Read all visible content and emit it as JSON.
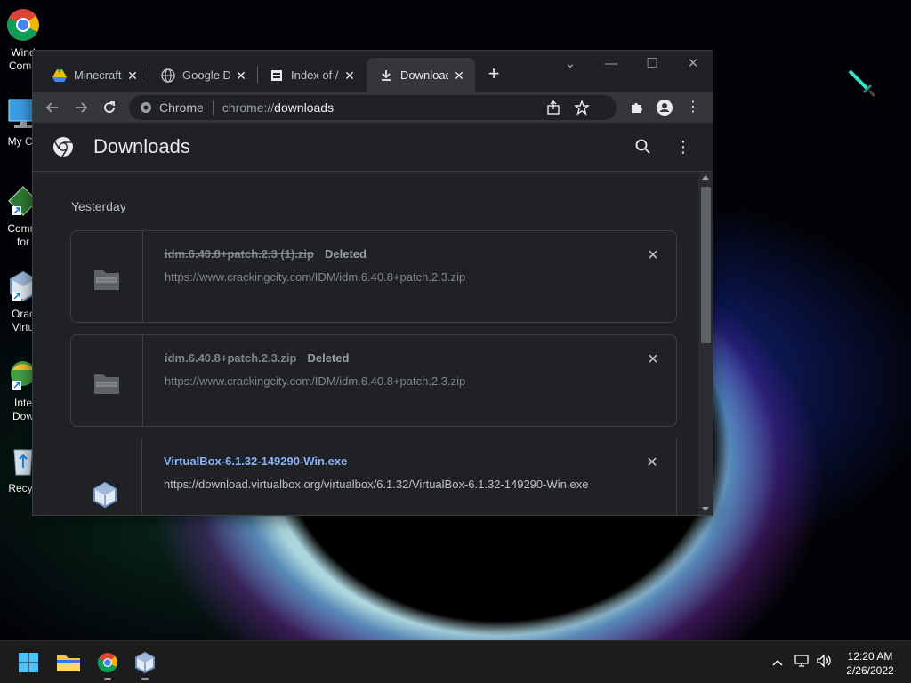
{
  "desktop": {
    "icons": [
      {
        "label": "Wind\nComp"
      },
      {
        "label": "My Co"
      },
      {
        "label": "Comm\nfor"
      },
      {
        "label": "Orac\nVirtu"
      },
      {
        "label": "Inte\nDow"
      },
      {
        "label": "Recyc"
      }
    ]
  },
  "browser": {
    "tabs": [
      {
        "title": "Minecraft",
        "favicon": "google-drive-icon",
        "active": false
      },
      {
        "title": "Google Dr",
        "favicon": "globe-icon",
        "active": false
      },
      {
        "title": "Index of /",
        "favicon": "index-icon",
        "active": false
      },
      {
        "title": "Downloads",
        "favicon": "download-icon",
        "active": true
      }
    ],
    "omnibox": {
      "chip": "Chrome",
      "url_scheme": "chrome://",
      "url_host": "downloads"
    }
  },
  "downloads_page": {
    "title": "Downloads",
    "date_label": "Yesterday",
    "items": [
      {
        "filename": "idm.6.40.8+patch.2.3 (1).zip",
        "status": "Deleted",
        "url": "https://www.crackingcity.com/IDM/idm.6.40.8+patch.2.3.zip",
        "deleted": true,
        "icon": "zip-folder-icon"
      },
      {
        "filename": "idm.6.40.8+patch.2.3.zip",
        "status": "Deleted",
        "url": "https://www.crackingcity.com/IDM/idm.6.40.8+patch.2.3.zip",
        "deleted": true,
        "icon": "zip-folder-icon"
      },
      {
        "filename": "VirtualBox-6.1.32-149290-Win.exe",
        "status": "",
        "url": "https://download.virtualbox.org/virtualbox/6.1.32/VirtualBox-6.1.32-149290-Win.exe",
        "deleted": false,
        "icon": "virtualbox-icon"
      }
    ]
  },
  "taskbar": {
    "time": "12:20 AM",
    "date": "2/26/2022"
  },
  "colors": {
    "link": "#8ab4f8",
    "page_bg": "#202124",
    "toolbar_bg": "#35363a"
  }
}
